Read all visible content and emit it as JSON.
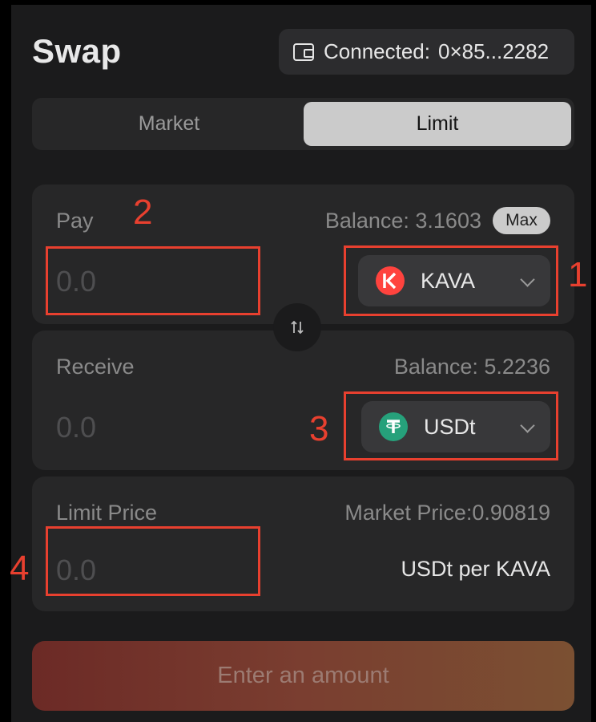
{
  "header": {
    "title": "Swap",
    "connection": {
      "label": "Connected:",
      "address": "0×85...2282"
    }
  },
  "tabs": [
    {
      "label": "Market",
      "active": false
    },
    {
      "label": "Limit",
      "active": true
    }
  ],
  "pay": {
    "label": "Pay",
    "balance": "Balance: 3.1603",
    "max_label": "Max",
    "amount_placeholder": "0.0",
    "token": {
      "symbol": "KAVA",
      "icon": "kava-logo-icon",
      "color": "#ff433e"
    }
  },
  "receive": {
    "label": "Receive",
    "balance": "Balance: 5.2236",
    "amount_placeholder": "0.0",
    "token": {
      "symbol": "USDt",
      "icon": "tether-logo-icon",
      "color": "#26a17b"
    }
  },
  "limit": {
    "label": "Limit Price",
    "market_price": "Market Price:0.90819",
    "amount_placeholder": "0.0",
    "unit": "USDt per KAVA"
  },
  "submit": {
    "label": "Enter an amount"
  },
  "annotations": {
    "n1": "1",
    "n2": "2",
    "n3": "3",
    "n4": "4",
    "color": "#e8402f"
  }
}
